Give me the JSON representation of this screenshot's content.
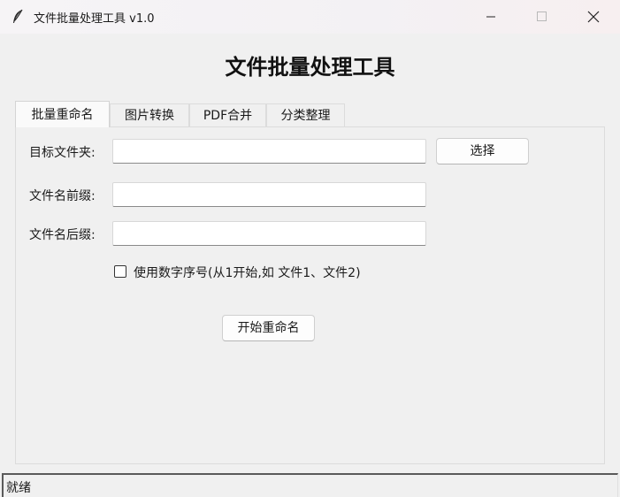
{
  "window": {
    "title": "文件批量处理工具 v1.0",
    "icon": "feather-icon"
  },
  "controls": {
    "minimize_icon": "minimize-icon",
    "maximize_icon": "maximize-icon",
    "close_icon": "close-icon"
  },
  "header": {
    "title": "文件批量处理工具"
  },
  "tabs": [
    {
      "label": "批量重命名",
      "active": true
    },
    {
      "label": "图片转换",
      "active": false
    },
    {
      "label": "PDF合并",
      "active": false
    },
    {
      "label": "分类整理",
      "active": false
    }
  ],
  "rename_form": {
    "target_folder_label": "目标文件夹:",
    "target_folder_value": "",
    "select_button": "选择",
    "prefix_label": "文件名前缀:",
    "prefix_value": "",
    "suffix_label": "文件名后缀:",
    "suffix_value": "",
    "use_number_label": "使用数字序号(从1开始,如 文件1、文件2)",
    "use_number_checked": false,
    "start_button": "开始重命名"
  },
  "status": {
    "text": "就绪"
  }
}
